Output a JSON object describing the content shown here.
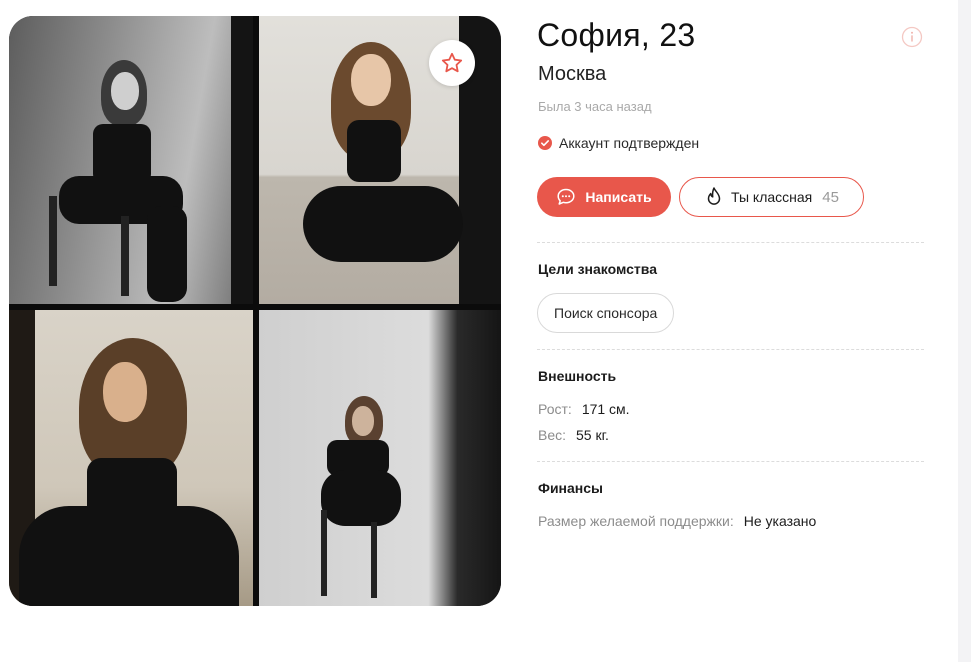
{
  "profile": {
    "name_age": "София, 23",
    "city": "Москва",
    "last_seen": "Была 3 часа назад",
    "verified_label": "Аккаунт подтвержден"
  },
  "actions": {
    "write_label": "Написать",
    "like_label": "Ты классная",
    "like_count": "45"
  },
  "sections": {
    "goals": {
      "title": "Цели знакомства",
      "chips": [
        "Поиск спонсора"
      ]
    },
    "appearance": {
      "title": "Внешность",
      "rows": [
        {
          "label": "Рост:",
          "value": "171 см."
        },
        {
          "label": "Вес:",
          "value": "55 кг."
        }
      ]
    },
    "finance": {
      "title": "Финансы",
      "rows": [
        {
          "label": "Размер желаемой поддержки:",
          "value": "Не указано"
        }
      ]
    }
  },
  "icons": {
    "favorite": "star-icon",
    "info": "info-icon",
    "verified": "check-circle-icon",
    "write": "chat-bubble-icon",
    "like": "flame-icon"
  },
  "colors": {
    "accent": "#e8574b",
    "muted_text": "#a9a9a9",
    "divider": "#dcdcdc"
  }
}
